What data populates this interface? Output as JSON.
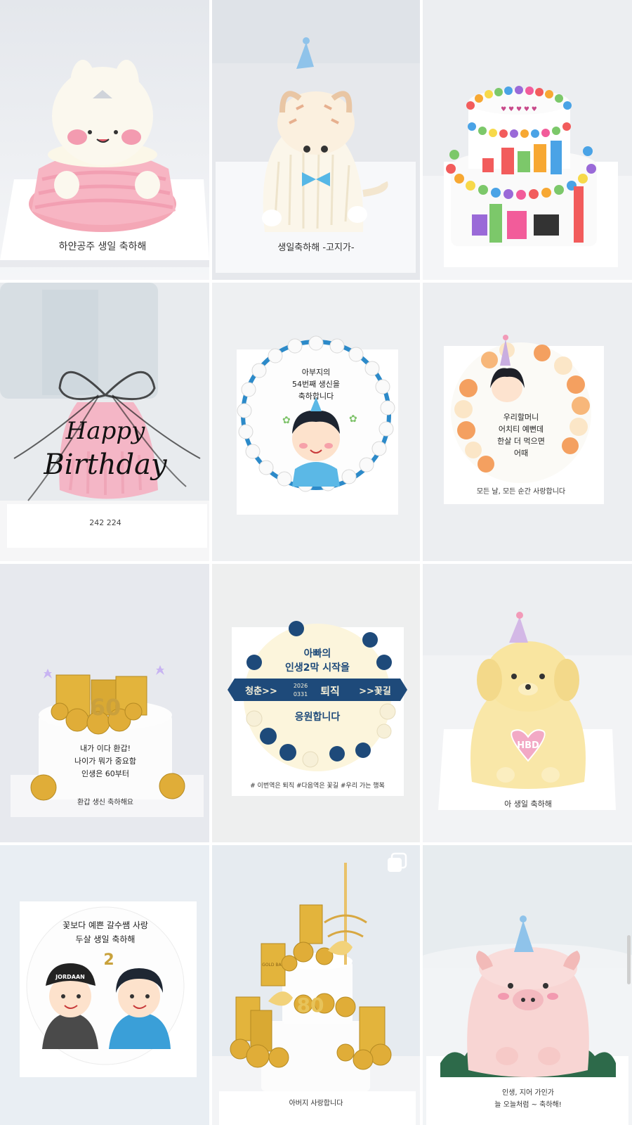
{
  "posts": [
    {
      "id": "rabbit",
      "icon": "rabbit-cake-thumbnail",
      "text": "하얀공주 생일 축하해"
    },
    {
      "id": "cat",
      "icon": "cat-cake-thumbnail",
      "text": "생일축하해 -고지가-"
    },
    {
      "id": "numberblocks",
      "icon": "numberblocks-cake-thumbnail"
    },
    {
      "id": "happy-birthday",
      "icon": "happy-birthday-cake-thumbnail",
      "topper_line1": "Happy",
      "topper_line2": "Birthday",
      "text": "242 224"
    },
    {
      "id": "dad-54",
      "icon": "dad-portrait-cake-thumbnail",
      "line1": "아부지의",
      "line2": "54번째 생신을",
      "line3": "축하합니다"
    },
    {
      "id": "grandma",
      "icon": "grandma-flower-cake-thumbnail",
      "line1": "우리할머니",
      "line2": "어치티 예뻔데",
      "line3": "한살 더 먹으면",
      "line4": "어때",
      "footer": "모든 날, 모든 순간 사랑합니다"
    },
    {
      "id": "gold-60",
      "icon": "gold-bar-cake-thumbnail",
      "number": "60",
      "line1": "내가 이다 환갑!",
      "line2": "나이가 뭐가 중요함",
      "line3": "인생은 60부터",
      "footer": "환갑 생신 축하해요"
    },
    {
      "id": "retirement",
      "icon": "retirement-cake-thumbnail",
      "line1": "아빠의",
      "line2": "인생2막 시작을",
      "ribbon_left": "청춘>>",
      "ribbon_date1": "2026",
      "ribbon_date2": "0331",
      "ribbon_mid": "퇴직",
      "ribbon_right": ">>꽃길",
      "line3": "응원합니다",
      "footer": "# 이번역은 퇴직 #다음역은 꽃길 #우리 가는 행복"
    },
    {
      "id": "puppy",
      "icon": "puppy-cake-thumbnail",
      "heart": "HBD",
      "text": "아 생일 축하해"
    },
    {
      "id": "couple",
      "icon": "couple-portrait-cake-thumbnail",
      "line1": "꽃보다 예쁜 갈수쌤 사랑",
      "line2": "두살 생일 축하해",
      "number": "2",
      "cap": "JORDAAN"
    },
    {
      "id": "gold-80",
      "icon": "gold-tower-cake-thumbnail",
      "number": "80",
      "footer": "아버지 사랑합니다",
      "bar_label": "GOLD BAR"
    },
    {
      "id": "pig",
      "icon": "pig-cake-thumbnail",
      "text1": "인생, 지어 가인가",
      "text2": "늘 오늘처럼 ~ 축하해!"
    }
  ],
  "ui": {
    "multi_image_icon": "carousel-multiple-icon"
  }
}
